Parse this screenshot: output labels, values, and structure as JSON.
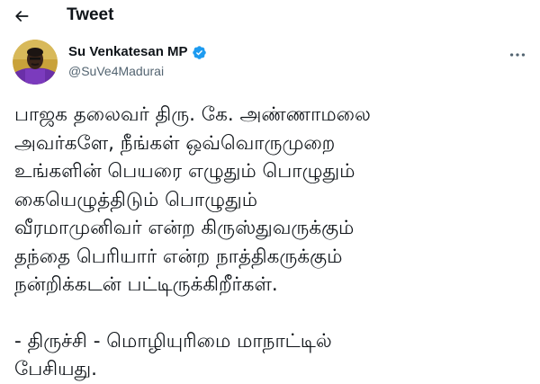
{
  "header": {
    "back_icon": "arrow-left-icon",
    "title": "Tweet"
  },
  "author": {
    "name": "Su Venkatesan MP",
    "verified": true,
    "verified_color": "#1d9bf0",
    "handle": "@SuVe4Madurai",
    "avatar_icon": "profile-photo"
  },
  "more_icon": "more-horizontal-icon",
  "tweet": {
    "paragraph_1_lines": [
      "பாஜக தலைவர் திரு. கே. அண்ணாமலை",
      "அவர்களே, நீங்கள்  ஒவ்வொருமுறை",
      "உங்களின் பெயரை எழுதும் பொழுதும்",
      "கையெழுத்திடும் பொழுதும்",
      "வீரமாமுனிவர் என்ற கிருஸ்துவருக்கும்",
      "தந்தை பெரியார் என்ற நாத்திகருக்கும்",
      "நன்றிக்கடன் பட்டிருக்கிறீர்கள்."
    ],
    "paragraph_2_lines": [
      "- திருச்சி - மொழியுரிமை மாநாட்டில்",
      "பேசியது."
    ]
  }
}
